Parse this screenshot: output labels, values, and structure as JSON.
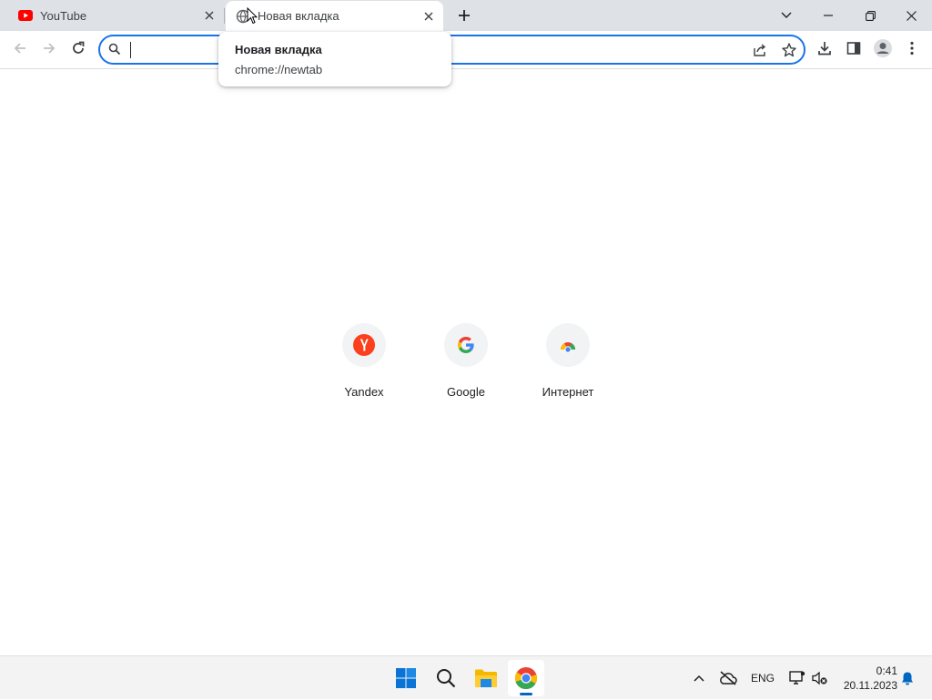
{
  "browser": {
    "tabs": [
      {
        "title": "YouTube",
        "favicon": "youtube-icon",
        "active": false
      },
      {
        "title": "Новая вкладка",
        "favicon": "globe-icon",
        "active": true
      }
    ],
    "new_tab_icon": "plus-icon",
    "window_controls": [
      "tab-search-icon",
      "minimize-icon",
      "restore-icon",
      "close-icon"
    ]
  },
  "toolbar": {
    "nav_icons": [
      "back-arrow-icon",
      "forward-arrow-icon",
      "reload-icon"
    ],
    "omnibox": {
      "value": "",
      "search_icon": "search-icon",
      "right_icons": [
        "share-icon",
        "bookmark-star-icon"
      ]
    },
    "right_icons": [
      "download-icon",
      "side-panel-icon",
      "profile-avatar-icon",
      "more-vert-icon"
    ]
  },
  "tooltip": {
    "title": "Новая вкладка",
    "url": "chrome://newtab"
  },
  "shortcuts": [
    {
      "label": "Yandex",
      "icon": "yandex-icon"
    },
    {
      "label": "Google",
      "icon": "google-icon"
    },
    {
      "label": "Интернет",
      "icon": "chrome-icon"
    }
  ],
  "taskbar": {
    "apps": [
      "windows-start-icon",
      "search-icon",
      "file-explorer-icon",
      "chrome-icon"
    ],
    "active_app": "chrome-icon",
    "tray": {
      "language": "ENG",
      "time": "0:41",
      "date": "20.11.2023"
    }
  },
  "colors": {
    "accent": "#1a73e8",
    "tab_strip": "#dee1e6",
    "youtube_red": "#ff0000",
    "yandex_red": "#fc3f1d",
    "taskbar": "#f3f3f3"
  }
}
